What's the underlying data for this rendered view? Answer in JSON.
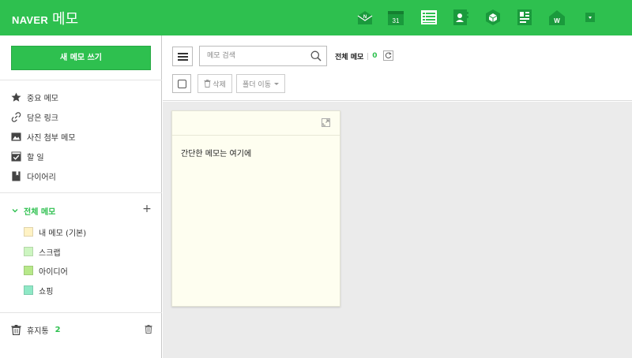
{
  "header": {
    "brand": "NAVER",
    "app_name": "메모",
    "bg_color": "#2ec04f",
    "app_icons": [
      {
        "name": "mail-icon"
      },
      {
        "name": "calendar-icon",
        "text": "31"
      },
      {
        "name": "memo-icon",
        "active": true
      },
      {
        "name": "contacts-icon"
      },
      {
        "name": "mybox-icon"
      },
      {
        "name": "office-icon"
      },
      {
        "name": "blog-icon",
        "text": "W"
      },
      {
        "name": "more-icon"
      }
    ]
  },
  "sidebar": {
    "new_memo_label": "새 메모 쓰기",
    "menu": [
      {
        "label": "중요 메모",
        "icon": "star-icon"
      },
      {
        "label": "담은 링크",
        "icon": "link-icon"
      },
      {
        "label": "사진 첨부 메모",
        "icon": "image-icon"
      },
      {
        "label": "할 일",
        "icon": "checkbox-icon"
      },
      {
        "label": "다이어리",
        "icon": "diary-icon"
      }
    ],
    "all_memo_label": "전체 메모",
    "folders": [
      {
        "label": "내 메모 (기본)",
        "color": "#fff2c4"
      },
      {
        "label": "스크랩",
        "color": "#cdf5c1"
      },
      {
        "label": "아이디어",
        "color": "#b7e88a"
      },
      {
        "label": "쇼핑",
        "color": "#8fe8c6"
      }
    ],
    "trash_label": "휴지통",
    "trash_count": "2"
  },
  "toolbar": {
    "search_placeholder": "메모 검색",
    "total_label": "전체 메모",
    "total_count": "0",
    "delete_label": "삭제",
    "move_folder_label": "폴더 이동"
  },
  "memo": {
    "text": "간단한 메모는 여기에"
  },
  "colors": {
    "accent": "#2ec04f",
    "content_bg": "#ebebeb",
    "memo_bg": "#fefef0"
  }
}
